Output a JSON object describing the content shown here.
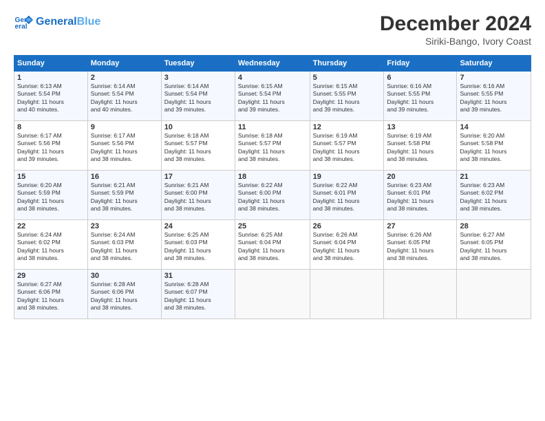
{
  "header": {
    "logo_line1": "General",
    "logo_line2": "Blue",
    "title": "December 2024",
    "subtitle": "Siriki-Bango, Ivory Coast"
  },
  "calendar": {
    "days_of_week": [
      "Sunday",
      "Monday",
      "Tuesday",
      "Wednesday",
      "Thursday",
      "Friday",
      "Saturday"
    ],
    "weeks": [
      [
        {
          "day": "1",
          "info": "Sunrise: 6:13 AM\nSunset: 5:54 PM\nDaylight: 11 hours\nand 40 minutes."
        },
        {
          "day": "2",
          "info": "Sunrise: 6:14 AM\nSunset: 5:54 PM\nDaylight: 11 hours\nand 40 minutes."
        },
        {
          "day": "3",
          "info": "Sunrise: 6:14 AM\nSunset: 5:54 PM\nDaylight: 11 hours\nand 39 minutes."
        },
        {
          "day": "4",
          "info": "Sunrise: 6:15 AM\nSunset: 5:54 PM\nDaylight: 11 hours\nand 39 minutes."
        },
        {
          "day": "5",
          "info": "Sunrise: 6:15 AM\nSunset: 5:55 PM\nDaylight: 11 hours\nand 39 minutes."
        },
        {
          "day": "6",
          "info": "Sunrise: 6:16 AM\nSunset: 5:55 PM\nDaylight: 11 hours\nand 39 minutes."
        },
        {
          "day": "7",
          "info": "Sunrise: 6:16 AM\nSunset: 5:55 PM\nDaylight: 11 hours\nand 39 minutes."
        }
      ],
      [
        {
          "day": "8",
          "info": "Sunrise: 6:17 AM\nSunset: 5:56 PM\nDaylight: 11 hours\nand 39 minutes."
        },
        {
          "day": "9",
          "info": "Sunrise: 6:17 AM\nSunset: 5:56 PM\nDaylight: 11 hours\nand 38 minutes."
        },
        {
          "day": "10",
          "info": "Sunrise: 6:18 AM\nSunset: 5:57 PM\nDaylight: 11 hours\nand 38 minutes."
        },
        {
          "day": "11",
          "info": "Sunrise: 6:18 AM\nSunset: 5:57 PM\nDaylight: 11 hours\nand 38 minutes."
        },
        {
          "day": "12",
          "info": "Sunrise: 6:19 AM\nSunset: 5:57 PM\nDaylight: 11 hours\nand 38 minutes."
        },
        {
          "day": "13",
          "info": "Sunrise: 6:19 AM\nSunset: 5:58 PM\nDaylight: 11 hours\nand 38 minutes."
        },
        {
          "day": "14",
          "info": "Sunrise: 6:20 AM\nSunset: 5:58 PM\nDaylight: 11 hours\nand 38 minutes."
        }
      ],
      [
        {
          "day": "15",
          "info": "Sunrise: 6:20 AM\nSunset: 5:59 PM\nDaylight: 11 hours\nand 38 minutes."
        },
        {
          "day": "16",
          "info": "Sunrise: 6:21 AM\nSunset: 5:59 PM\nDaylight: 11 hours\nand 38 minutes."
        },
        {
          "day": "17",
          "info": "Sunrise: 6:21 AM\nSunset: 6:00 PM\nDaylight: 11 hours\nand 38 minutes."
        },
        {
          "day": "18",
          "info": "Sunrise: 6:22 AM\nSunset: 6:00 PM\nDaylight: 11 hours\nand 38 minutes."
        },
        {
          "day": "19",
          "info": "Sunrise: 6:22 AM\nSunset: 6:01 PM\nDaylight: 11 hours\nand 38 minutes."
        },
        {
          "day": "20",
          "info": "Sunrise: 6:23 AM\nSunset: 6:01 PM\nDaylight: 11 hours\nand 38 minutes."
        },
        {
          "day": "21",
          "info": "Sunrise: 6:23 AM\nSunset: 6:02 PM\nDaylight: 11 hours\nand 38 minutes."
        }
      ],
      [
        {
          "day": "22",
          "info": "Sunrise: 6:24 AM\nSunset: 6:02 PM\nDaylight: 11 hours\nand 38 minutes."
        },
        {
          "day": "23",
          "info": "Sunrise: 6:24 AM\nSunset: 6:03 PM\nDaylight: 11 hours\nand 38 minutes."
        },
        {
          "day": "24",
          "info": "Sunrise: 6:25 AM\nSunset: 6:03 PM\nDaylight: 11 hours\nand 38 minutes."
        },
        {
          "day": "25",
          "info": "Sunrise: 6:25 AM\nSunset: 6:04 PM\nDaylight: 11 hours\nand 38 minutes."
        },
        {
          "day": "26",
          "info": "Sunrise: 6:26 AM\nSunset: 6:04 PM\nDaylight: 11 hours\nand 38 minutes."
        },
        {
          "day": "27",
          "info": "Sunrise: 6:26 AM\nSunset: 6:05 PM\nDaylight: 11 hours\nand 38 minutes."
        },
        {
          "day": "28",
          "info": "Sunrise: 6:27 AM\nSunset: 6:05 PM\nDaylight: 11 hours\nand 38 minutes."
        }
      ],
      [
        {
          "day": "29",
          "info": "Sunrise: 6:27 AM\nSunset: 6:06 PM\nDaylight: 11 hours\nand 38 minutes."
        },
        {
          "day": "30",
          "info": "Sunrise: 6:28 AM\nSunset: 6:06 PM\nDaylight: 11 hours\nand 38 minutes."
        },
        {
          "day": "31",
          "info": "Sunrise: 6:28 AM\nSunset: 6:07 PM\nDaylight: 11 hours\nand 38 minutes."
        },
        {
          "day": "",
          "info": ""
        },
        {
          "day": "",
          "info": ""
        },
        {
          "day": "",
          "info": ""
        },
        {
          "day": "",
          "info": ""
        }
      ]
    ]
  }
}
